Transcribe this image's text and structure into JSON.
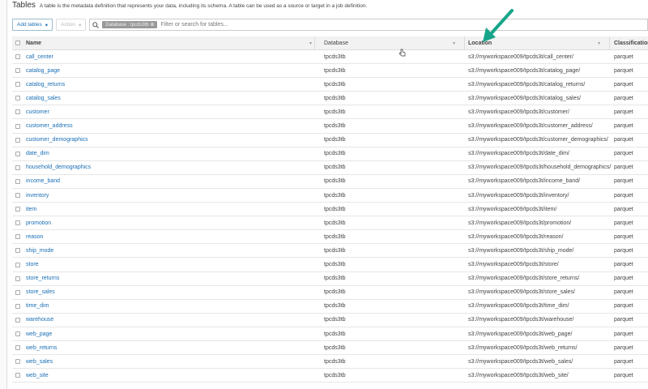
{
  "header": {
    "title": "Tables",
    "description": "A table is the metadata definition that represents your data, including its schema. A table can be used as a source or target in a job definition."
  },
  "toolbar": {
    "add_tables": "Add tables",
    "action": "Action",
    "filter_chip": "Database : tpcds3tb",
    "search_placeholder": "Filter or search for tables..."
  },
  "columns": {
    "name": "Name",
    "database": "Database",
    "location": "Location",
    "classification": "Classification"
  },
  "rows": [
    {
      "name": "call_center",
      "database": "tpcds3tb",
      "location": "s3://myworkspace009/tpcds3t/call_center/",
      "classification": "parquet"
    },
    {
      "name": "catalog_page",
      "database": "tpcds3tb",
      "location": "s3://myworkspace009/tpcds3t/catalog_page/",
      "classification": "parquet"
    },
    {
      "name": "catalog_returns",
      "database": "tpcds3tb",
      "location": "s3://myworkspace009/tpcds3t/catalog_returns/",
      "classification": "parquet"
    },
    {
      "name": "catalog_sales",
      "database": "tpcds3tb",
      "location": "s3://myworkspace009/tpcds3t/catalog_sales/",
      "classification": "parquet"
    },
    {
      "name": "customer",
      "database": "tpcds3tb",
      "location": "s3://myworkspace009/tpcds3t/customer/",
      "classification": "parquet"
    },
    {
      "name": "customer_address",
      "database": "tpcds3tb",
      "location": "s3://myworkspace009/tpcds3t/customer_address/",
      "classification": "parquet"
    },
    {
      "name": "customer_demographics",
      "database": "tpcds3tb",
      "location": "s3://myworkspace009/tpcds3t/customer_demographics/",
      "classification": "parquet"
    },
    {
      "name": "date_dim",
      "database": "tpcds3tb",
      "location": "s3://myworkspace009/tpcds3t/date_dim/",
      "classification": "parquet"
    },
    {
      "name": "household_demographics",
      "database": "tpcds3tb",
      "location": "s3://myworkspace009/tpcds3t/household_demographics/",
      "classification": "parquet"
    },
    {
      "name": "income_band",
      "database": "tpcds3tb",
      "location": "s3://myworkspace009/tpcds3t/income_band/",
      "classification": "parquet"
    },
    {
      "name": "inventory",
      "database": "tpcds3tb",
      "location": "s3://myworkspace009/tpcds3t/inventory/",
      "classification": "parquet"
    },
    {
      "name": "item",
      "database": "tpcds3tb",
      "location": "s3://myworkspace009/tpcds3t/item/",
      "classification": "parquet"
    },
    {
      "name": "promotion",
      "database": "tpcds3tb",
      "location": "s3://myworkspace009/tpcds3t/promotion/",
      "classification": "parquet"
    },
    {
      "name": "reason",
      "database": "tpcds3tb",
      "location": "s3://myworkspace009/tpcds3t/reason/",
      "classification": "parquet"
    },
    {
      "name": "ship_mode",
      "database": "tpcds3tb",
      "location": "s3://myworkspace009/tpcds3t/ship_mode/",
      "classification": "parquet"
    },
    {
      "name": "store",
      "database": "tpcds3tb",
      "location": "s3://myworkspace009/tpcds3t/store/",
      "classification": "parquet"
    },
    {
      "name": "store_returns",
      "database": "tpcds3tb",
      "location": "s3://myworkspace009/tpcds3t/store_returns/",
      "classification": "parquet"
    },
    {
      "name": "store_sales",
      "database": "tpcds3tb",
      "location": "s3://myworkspace009/tpcds3t/store_sales/",
      "classification": "parquet"
    },
    {
      "name": "time_dim",
      "database": "tpcds3tb",
      "location": "s3://myworkspace009/tpcds3t/time_dim/",
      "classification": "parquet"
    },
    {
      "name": "warehouse",
      "database": "tpcds3tb",
      "location": "s3://myworkspace009/tpcds3t/warehouse/",
      "classification": "parquet"
    },
    {
      "name": "web_page",
      "database": "tpcds3tb",
      "location": "s3://myworkspace009/tpcds3t/web_page/",
      "classification": "parquet"
    },
    {
      "name": "web_returns",
      "database": "tpcds3tb",
      "location": "s3://myworkspace009/tpcds3t/web_returns/",
      "classification": "parquet"
    },
    {
      "name": "web_sales",
      "database": "tpcds3tb",
      "location": "s3://myworkspace009/tpcds3t/web_sales/",
      "classification": "parquet"
    },
    {
      "name": "web_site",
      "database": "tpcds3tb",
      "location": "s3://myworkspace009/tpcds3t/web_site/",
      "classification": "parquet"
    }
  ],
  "colors": {
    "link": "#1a6fb5",
    "annotation_arrow": "#17a589"
  }
}
